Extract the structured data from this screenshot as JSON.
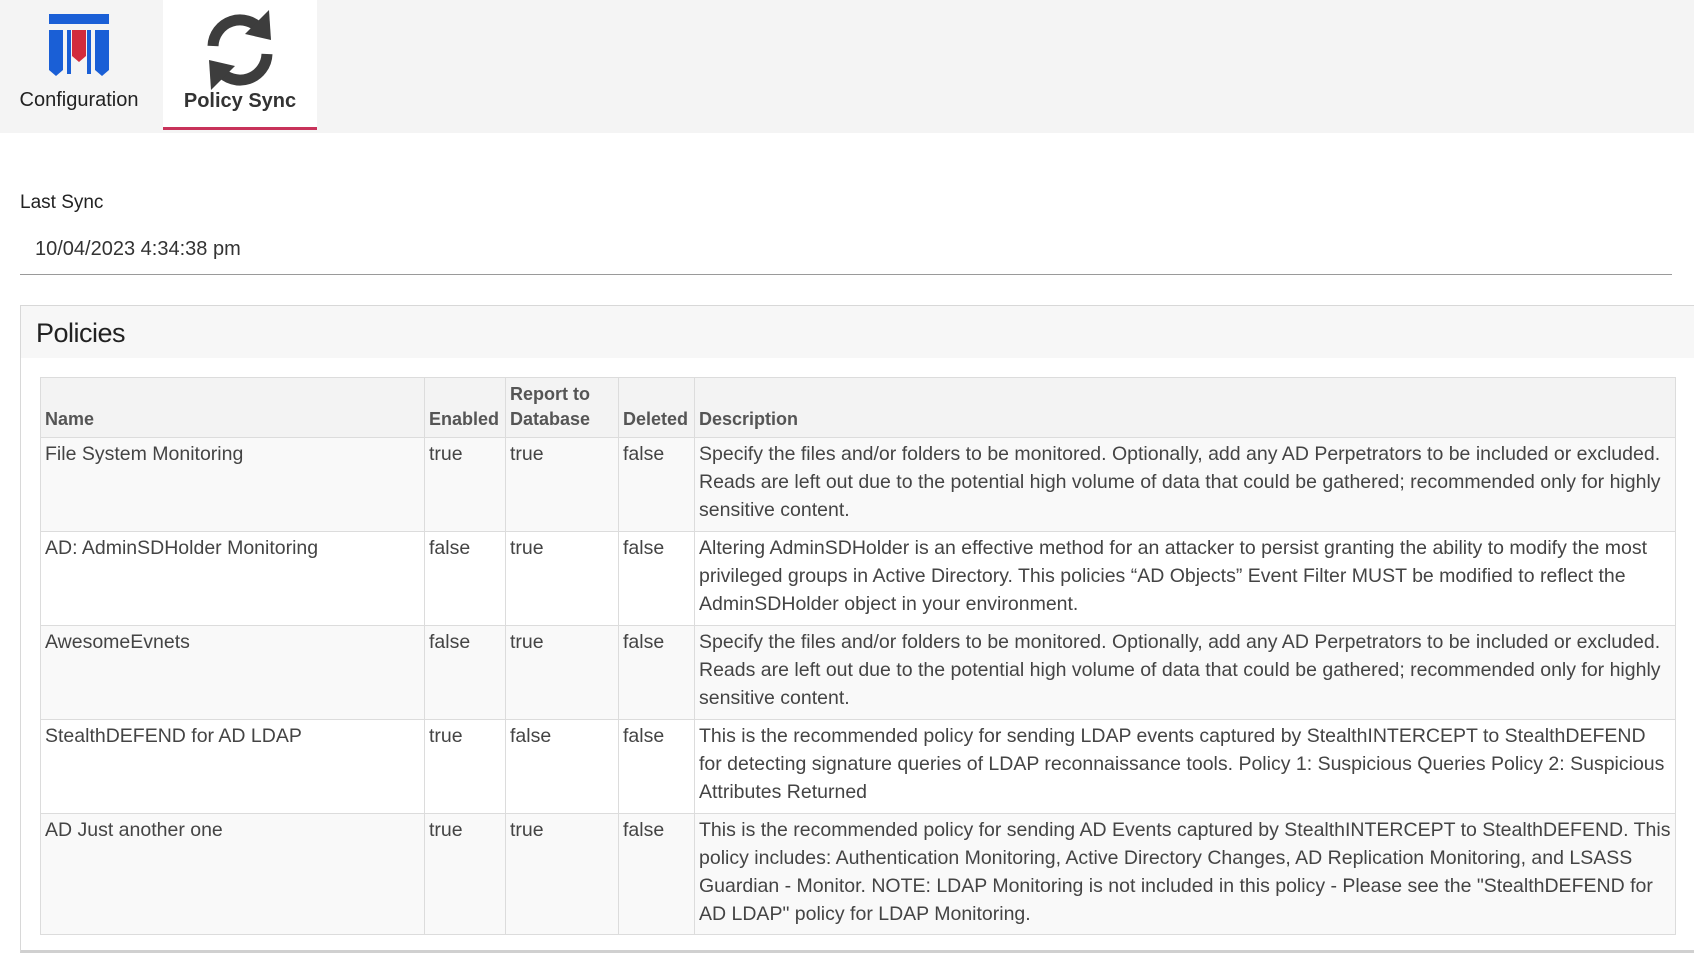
{
  "tabs": [
    {
      "label": "Configuration",
      "icon": "shield-logo-icon"
    },
    {
      "label": "Policy Sync",
      "icon": "sync-icon",
      "active": true
    }
  ],
  "last_sync": {
    "label": "Last Sync",
    "value": "10/04/2023 4:34:38 pm"
  },
  "policies": {
    "title": "Policies",
    "columns": {
      "name": "Name",
      "enabled": "Enabled",
      "report_to_database": "Report to Database",
      "deleted": "Deleted",
      "description": "Description"
    },
    "rows": [
      {
        "name": "File System Monitoring",
        "enabled": "true",
        "report_to_database": "true",
        "deleted": "false",
        "description": "Specify the files and/or folders to be monitored. Optionally, add any AD Perpetrators to be included or excluded. Reads are left out due to the potential high volume of data that could be gathered; recommended only for highly sensitive content."
      },
      {
        "name": "AD: AdminSDHolder Monitoring",
        "enabled": "false",
        "report_to_database": "true",
        "deleted": "false",
        "description": "Altering AdminSDHolder is an effective method for an attacker to persist granting the ability to modify the most privileged groups in Active Directory. This policies “AD Objects” Event Filter MUST be modified to reflect the AdminSDHolder object in your environment."
      },
      {
        "name": "AwesomeEvnets",
        "enabled": "false",
        "report_to_database": "true",
        "deleted": "false",
        "description": "Specify the files and/or folders to be monitored. Optionally, add any AD Perpetrators to be included or excluded. Reads are left out due to the potential high volume of data that could be gathered; recommended only for highly sensitive content."
      },
      {
        "name": "StealthDEFEND for AD LDAP",
        "enabled": "true",
        "report_to_database": "false",
        "deleted": "false",
        "description": "This is the recommended policy for sending LDAP events captured by StealthINTERCEPT to StealthDEFEND for detecting signature queries of LDAP reconnaissance tools. Policy 1: Suspicious Queries Policy 2: Suspicious Attributes Returned"
      },
      {
        "name": "AD Just another one",
        "enabled": "true",
        "report_to_database": "true",
        "deleted": "false",
        "description": "This is the recommended policy for sending AD Events captured by StealthINTERCEPT to StealthDEFEND. This policy includes: Authentication Monitoring, Active Directory Changes, AD Replication Monitoring, and LSASS Guardian - Monitor. NOTE: LDAP Monitoring is not included in this policy - Please see the \"StealthDEFEND for AD LDAP\" policy for LDAP Monitoring."
      }
    ]
  },
  "colors": {
    "brand_blue": "#1a5fd6",
    "brand_red": "#d22b3c",
    "sync_icon_gray": "#3d3d3d",
    "active_tab_underline": "#c8325a"
  }
}
